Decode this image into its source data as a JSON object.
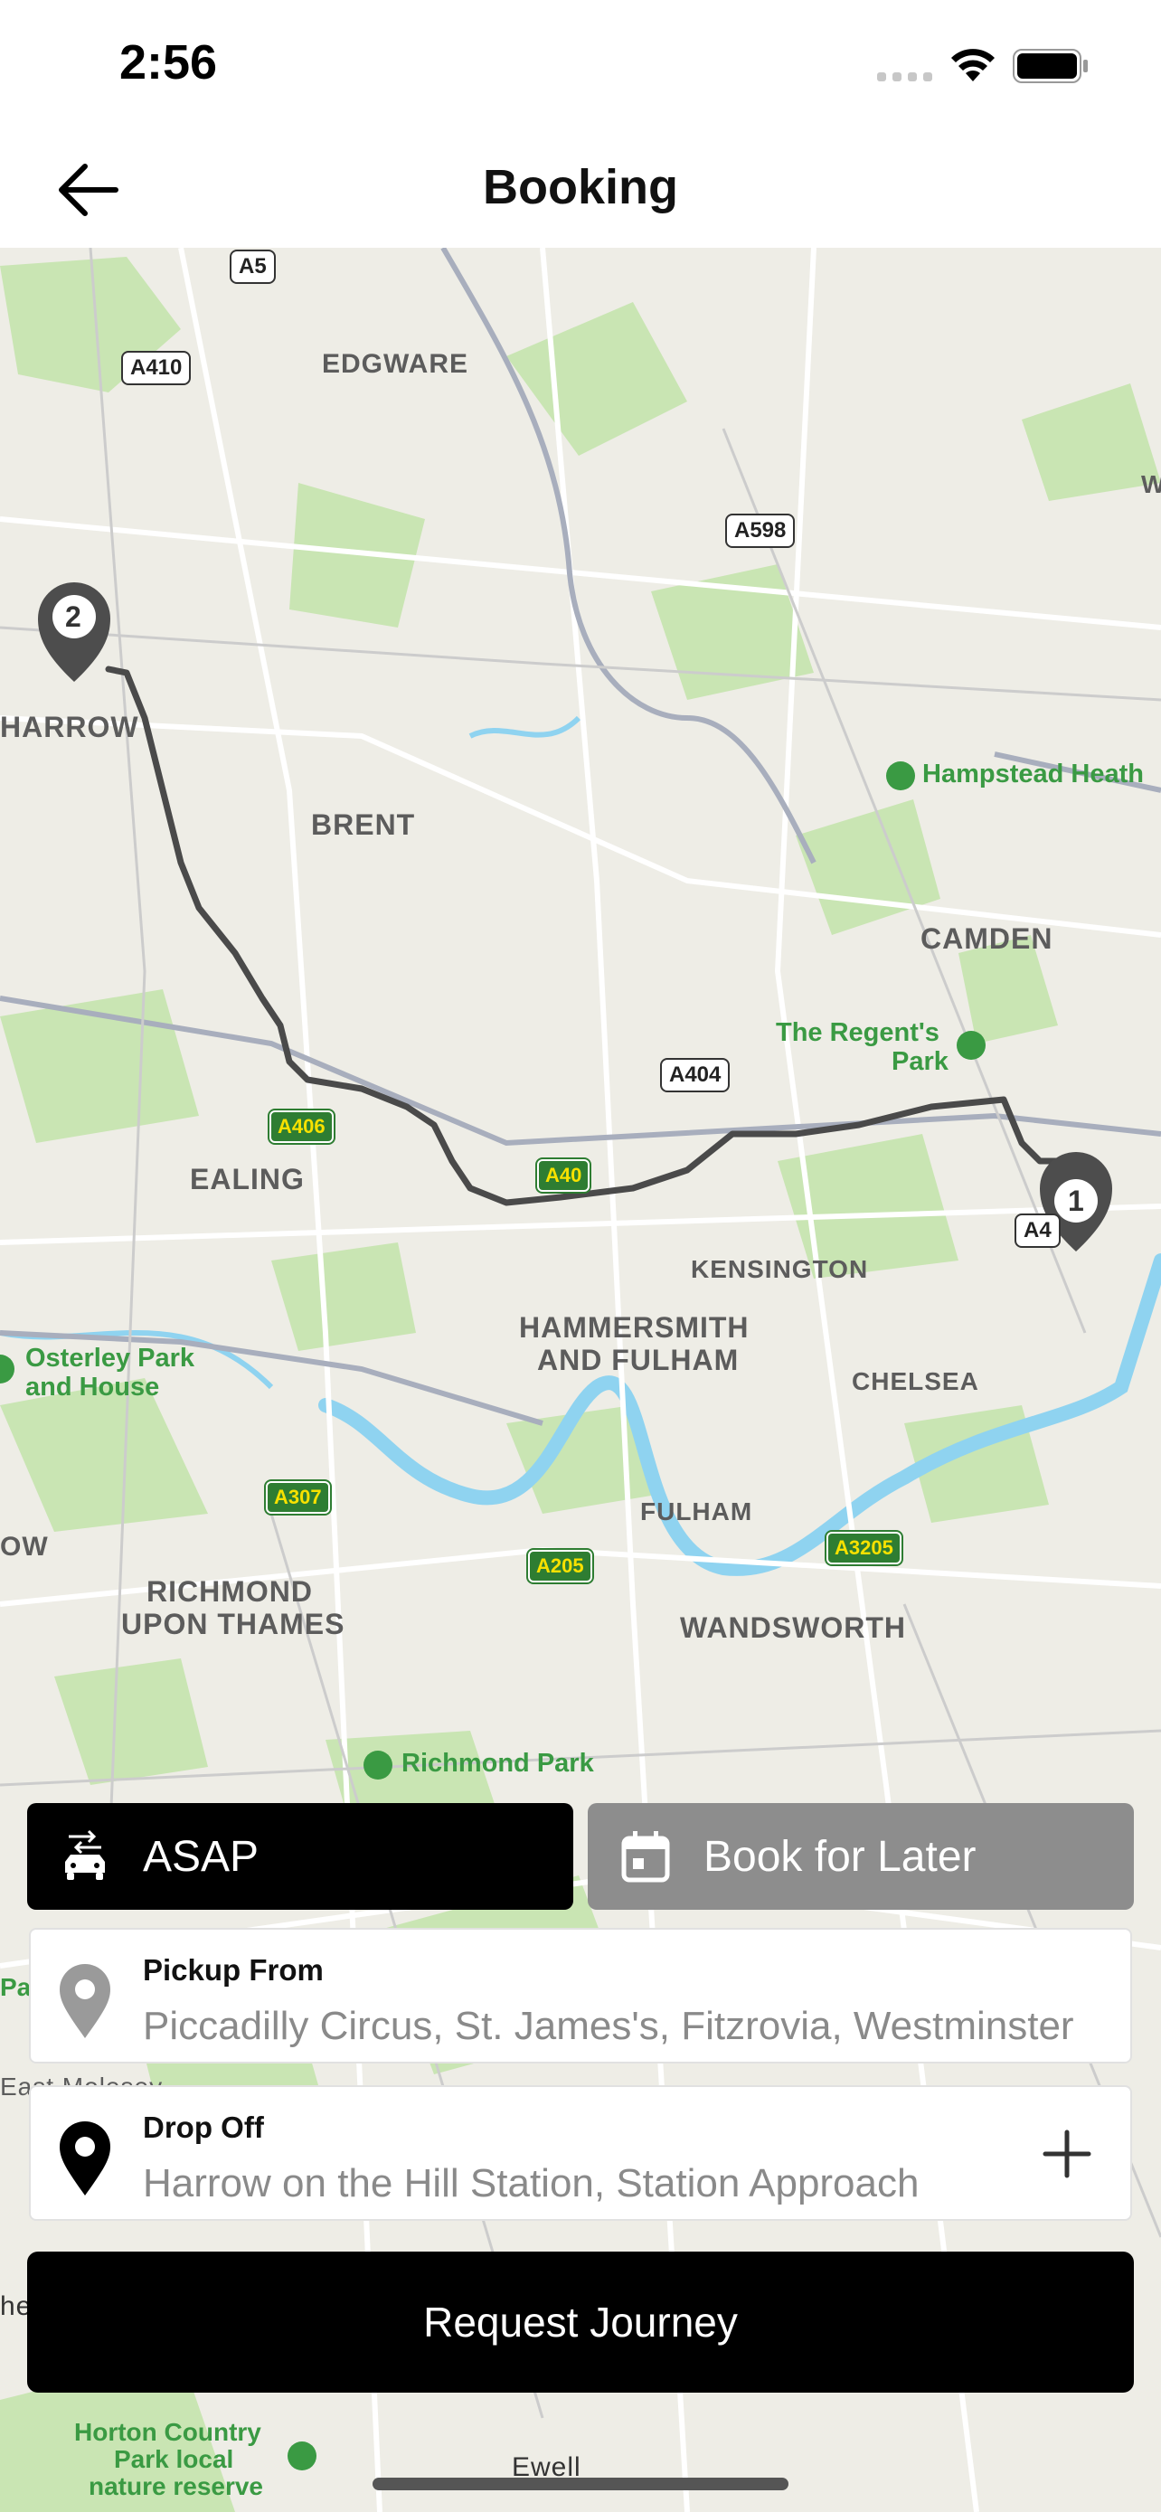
{
  "status": {
    "time": "2:56"
  },
  "nav": {
    "title": "Booking",
    "back_icon": "arrow-left-icon"
  },
  "map": {
    "labels": {
      "edgware": "EDGWARE",
      "harrow": "HARROW",
      "brent": "BRENT",
      "camden": "CAMDEN",
      "ealing": "EALING",
      "kensington": "KENSINGTON",
      "hammersmith1": "HAMMERSMITH",
      "hammersmith2": "AND FULHAM",
      "chelsea": "CHELSEA",
      "fulham": "FULHAM",
      "richmond1": "RICHMOND",
      "richmond2": "UPON THAMES",
      "wandsworth": "WANDSWORTH",
      "hampstead": "Hampstead Heath",
      "regents1": "The Regent's",
      "regents2": "Park",
      "osterley1": "Osterley Park",
      "osterley2": "and House",
      "richmond_park": "Richmond Park",
      "horton1": "Horton Country",
      "horton2": "Park local",
      "horton3": "nature reserve",
      "ewell": "Ewell",
      "east_molesey": "East Molesey",
      "edge_w": "W",
      "edge_ow": "OW",
      "edge_pa": "Pa",
      "edge_he": "he"
    },
    "roads": {
      "a5": "A5",
      "a410": "A410",
      "a598": "A598",
      "a404": "A404",
      "a4": "A4",
      "a406": "A406",
      "a40": "A40",
      "a307": "A307",
      "a205": "A205",
      "a3205": "A3205"
    },
    "markers": {
      "destination": "2",
      "origin": "1"
    }
  },
  "mode_toggle": {
    "asap_label": "ASAP",
    "later_label": "Book for Later",
    "asap_icon": "car-icon",
    "later_icon": "calendar-icon"
  },
  "pickup": {
    "label": "Pickup From",
    "value": "Piccadilly Circus, St. James's, Fitzrovia, Westminster"
  },
  "dropoff": {
    "label": "Drop Off",
    "value": "Harrow on the Hill Station, Station Approach"
  },
  "request_button": "Request Journey",
  "colors": {
    "accent": "#000000",
    "inactive": "#8d8d8d",
    "map_bg": "#eeede6",
    "park": "#c9e5b3",
    "water": "#8fd3f0",
    "route": "#4a4a4a"
  }
}
